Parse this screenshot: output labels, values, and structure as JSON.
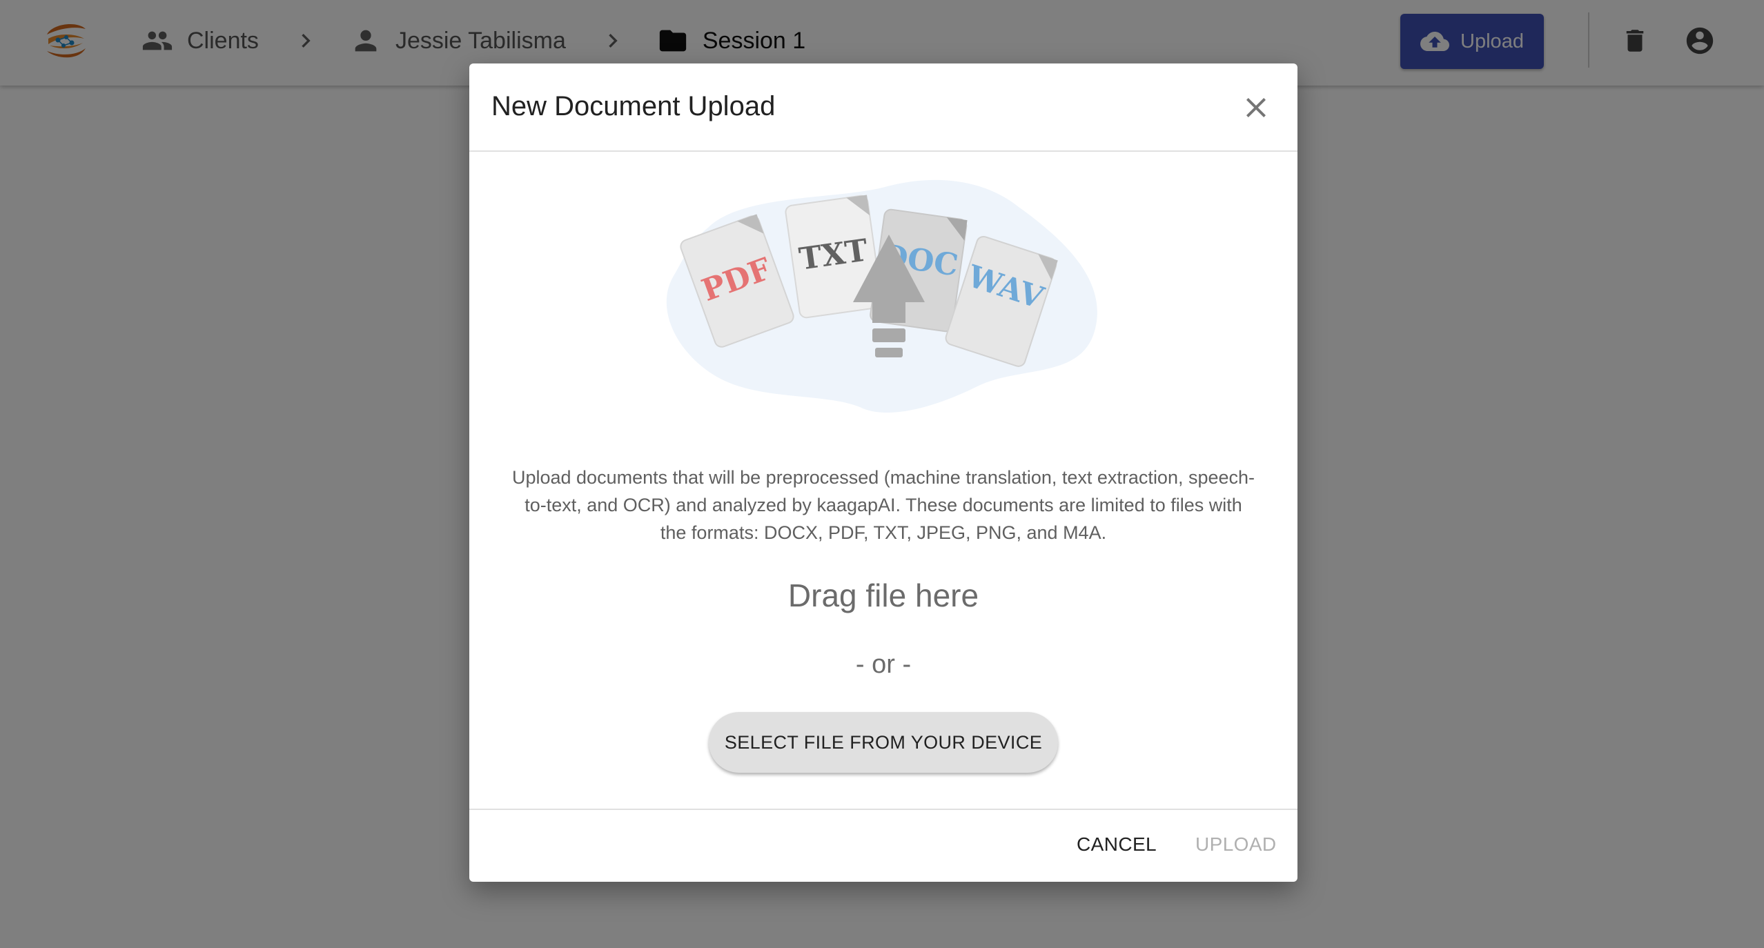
{
  "header": {
    "breadcrumb": [
      {
        "label": "Clients",
        "icon": "people-icon"
      },
      {
        "label": "Jessie Tabilisma",
        "icon": "person-icon"
      },
      {
        "label": "Session 1",
        "icon": "folder-icon"
      }
    ],
    "upload_label": "Upload",
    "accent_color": "#3f51b5"
  },
  "dialog": {
    "title": "New Document Upload",
    "illustration_labels": [
      "PDF",
      "TXT",
      "DOC",
      "WAV"
    ],
    "description": "Upload documents that will be preprocessed (machine translation, text extraction, speech-to-text, and OCR) and analyzed by kaagapAI. These documents are limited to files with the formats: DOCX, PDF, TXT, JPEG, PNG, and M4A.",
    "drag_text": "Drag file here",
    "or_text": "- or -",
    "select_label": "SELECT FILE FROM YOUR DEVICE",
    "cancel_label": "CANCEL",
    "upload_label": "UPLOAD"
  }
}
